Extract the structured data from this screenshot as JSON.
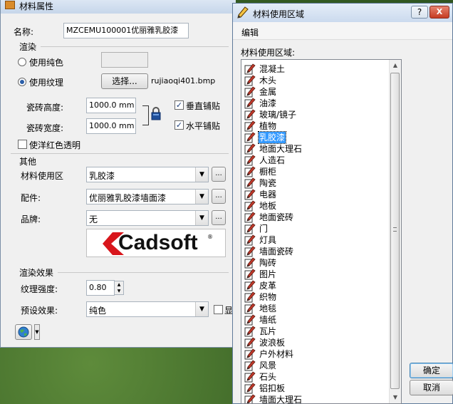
{
  "props_dialog": {
    "title": "材料属性",
    "name_label": "名称:",
    "name_value": "MZCEMU100001优丽雅乳胶漆",
    "render_section": "渲染",
    "solid_color_label": "使用纯色",
    "texture_label": "使用纹理",
    "choose_button": "选择...",
    "texture_file": "rujiaoqi401.bmp",
    "tile_height_label": "瓷砖高度:",
    "tile_height_value": "1000.0 mm",
    "tile_width_label": "瓷砖宽度:",
    "tile_width_value": "1000.0 mm",
    "vertical_tile_label": "垂直铺贴",
    "horizontal_tile_label": "水平铺贴",
    "red_transparent_label": "使洋红色透明",
    "other_section": "其他",
    "usage_area_label": "材料使用区",
    "usage_area_value": "乳胶漆",
    "parts_label": "配件:",
    "parts_value": "优丽雅乳胶漆墙面漆",
    "brand_label": "品牌:",
    "brand_value": "无",
    "logo_text": "Cadsoft",
    "logo_registered": "®",
    "ellipsis": "...",
    "render_effect_section": "渲染效果",
    "texture_strength_label": "纹理强度:",
    "texture_strength_value": "0.80",
    "preset_effect_label": "预设效果:",
    "preset_effect_value": "纯色",
    "preset_check_label": "显"
  },
  "usage_dialog": {
    "title": "材料使用区域",
    "help_button": "?",
    "close_button": "X",
    "menu_edit": "编辑",
    "list_label": "材料使用区域:",
    "items": [
      "混凝土",
      "木头",
      "金属",
      "油漆",
      "玻璃/镜子",
      "植物",
      "乳胶漆",
      "地面大理石",
      "人造石",
      "橱柜",
      "陶瓷",
      "电器",
      "地板",
      "地面瓷砖",
      "门",
      "灯具",
      "墙面瓷砖",
      "陶砖",
      "图片",
      "皮革",
      "织物",
      "地毯",
      "墙纸",
      "瓦片",
      "波浪板",
      "户外材料",
      "风景",
      "石头",
      "铝扣板",
      "墙面大理石"
    ],
    "selected_index": 6,
    "ok_button": "确定",
    "cancel_button": "取消"
  }
}
